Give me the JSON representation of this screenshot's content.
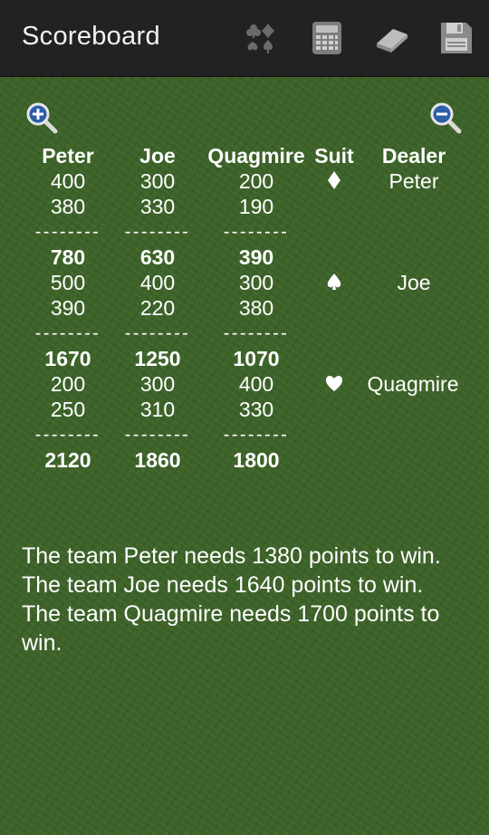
{
  "app": {
    "title": "Scoreboard",
    "toolbar": [
      {
        "name": "cards-suits-icon"
      },
      {
        "name": "calculator-icon"
      },
      {
        "name": "eraser-icon"
      },
      {
        "name": "save-icon"
      }
    ]
  },
  "zoom": {
    "in": "zoom-in-icon",
    "out": "zoom-out-icon"
  },
  "headers": {
    "p1": "Peter",
    "p2": "Joe",
    "p3": "Quagmire",
    "suit": "Suit",
    "dealer": "Dealer"
  },
  "separator": "--------",
  "rounds": [
    {
      "rows": [
        [
          "400",
          "300",
          "200"
        ],
        [
          "380",
          "330",
          "190"
        ]
      ],
      "total": [
        "780",
        "630",
        "390"
      ],
      "suit": "diamond",
      "dealer": "Peter"
    },
    {
      "rows": [
        [
          "500",
          "400",
          "300"
        ],
        [
          "390",
          "220",
          "380"
        ]
      ],
      "total": [
        "1670",
        "1250",
        "1070"
      ],
      "suit": "spade",
      "dealer": "Joe"
    },
    {
      "rows": [
        [
          "200",
          "300",
          "400"
        ],
        [
          "250",
          "310",
          "330"
        ]
      ],
      "total": [
        "2120",
        "1860",
        "1800"
      ],
      "suit": "heart",
      "dealer": "Quagmire"
    }
  ],
  "messages": [
    "The team Peter needs 1380 points to win.",
    "The team Joe needs 1640 points to win.",
    "The team Quagmire needs 1700 points to win."
  ]
}
